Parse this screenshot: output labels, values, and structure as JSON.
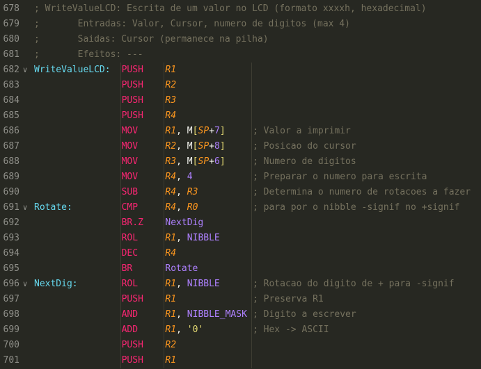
{
  "colors": {
    "background": "#272822",
    "line_number": "#90908a",
    "comment": "#75715e",
    "label": "#66d9ef",
    "instruction": "#f92672",
    "register": "#fd971f",
    "identifier": "#ae81ff",
    "text": "#f8f8f2"
  },
  "lines": [
    {
      "n": "678",
      "fold": "",
      "tokens": [
        {
          "t": "; WriteValueLCD: Escrita de um valor no LCD (formato xxxxh, hexadecimal)",
          "c": "comment",
          "col": 0
        }
      ]
    },
    {
      "n": "679",
      "fold": "",
      "tokens": [
        {
          "t": ";       Entradas: Valor, Cursor, numero de digitos (max 4)",
          "c": "comment",
          "col": 0
        }
      ]
    },
    {
      "n": "680",
      "fold": "",
      "tokens": [
        {
          "t": ";       Saidas: Cursor (permanece na pilha)",
          "c": "comment",
          "col": 0
        }
      ]
    },
    {
      "n": "681",
      "fold": "",
      "tokens": [
        {
          "t": ";       Efeitos: ---",
          "c": "comment",
          "col": 0
        }
      ]
    },
    {
      "n": "682",
      "fold": "v",
      "tokens": [
        {
          "t": "WriteValueLCD:",
          "c": "label",
          "col": 0
        },
        {
          "t": "PUSH",
          "c": "instr",
          "col": 16
        },
        {
          "t": "R1",
          "c": "reg",
          "col": 24
        }
      ]
    },
    {
      "n": "683",
      "fold": "",
      "tokens": [
        {
          "t": "PUSH",
          "c": "instr",
          "col": 16
        },
        {
          "t": "R2",
          "c": "reg",
          "col": 24
        }
      ]
    },
    {
      "n": "684",
      "fold": "",
      "tokens": [
        {
          "t": "PUSH",
          "c": "instr",
          "col": 16
        },
        {
          "t": "R3",
          "c": "reg",
          "col": 24
        }
      ]
    },
    {
      "n": "685",
      "fold": "",
      "tokens": [
        {
          "t": "PUSH",
          "c": "instr",
          "col": 16
        },
        {
          "t": "R4",
          "c": "reg",
          "col": 24
        }
      ]
    },
    {
      "n": "686",
      "fold": "",
      "tokens": [
        {
          "t": "MOV",
          "c": "instr",
          "col": 16
        },
        {
          "t": "R1",
          "c": "reg",
          "col": 24
        },
        {
          "t": ", M",
          "c": "plain",
          "col": 26
        },
        {
          "t": "[",
          "c": "bracket",
          "col": 29
        },
        {
          "t": "SP",
          "c": "reg",
          "col": 30
        },
        {
          "t": "+",
          "c": "plain",
          "col": 32
        },
        {
          "t": "7",
          "c": "num",
          "col": 33
        },
        {
          "t": "]",
          "c": "bracket",
          "col": 34
        },
        {
          "t": "; Valor a imprimir",
          "c": "comment",
          "col": 40
        }
      ]
    },
    {
      "n": "687",
      "fold": "",
      "tokens": [
        {
          "t": "MOV",
          "c": "instr",
          "col": 16
        },
        {
          "t": "R2",
          "c": "reg",
          "col": 24
        },
        {
          "t": ", M",
          "c": "plain",
          "col": 26
        },
        {
          "t": "[",
          "c": "bracket",
          "col": 29
        },
        {
          "t": "SP",
          "c": "reg",
          "col": 30
        },
        {
          "t": "+",
          "c": "plain",
          "col": 32
        },
        {
          "t": "8",
          "c": "num",
          "col": 33
        },
        {
          "t": "]",
          "c": "bracket",
          "col": 34
        },
        {
          "t": "; Posicao do cursor",
          "c": "comment",
          "col": 40
        }
      ]
    },
    {
      "n": "688",
      "fold": "",
      "tokens": [
        {
          "t": "MOV",
          "c": "instr",
          "col": 16
        },
        {
          "t": "R3",
          "c": "reg",
          "col": 24
        },
        {
          "t": ", M",
          "c": "plain",
          "col": 26
        },
        {
          "t": "[",
          "c": "bracket",
          "col": 29
        },
        {
          "t": "SP",
          "c": "reg",
          "col": 30
        },
        {
          "t": "+",
          "c": "plain",
          "col": 32
        },
        {
          "t": "6",
          "c": "num",
          "col": 33
        },
        {
          "t": "]",
          "c": "bracket",
          "col": 34
        },
        {
          "t": "; Numero de digitos",
          "c": "comment",
          "col": 40
        }
      ]
    },
    {
      "n": "689",
      "fold": "",
      "tokens": [
        {
          "t": "MOV",
          "c": "instr",
          "col": 16
        },
        {
          "t": "R4",
          "c": "reg",
          "col": 24
        },
        {
          "t": ", ",
          "c": "plain",
          "col": 26
        },
        {
          "t": "4",
          "c": "num",
          "col": 28
        },
        {
          "t": "; Preparar o numero para escrita",
          "c": "comment",
          "col": 40
        }
      ]
    },
    {
      "n": "690",
      "fold": "",
      "tokens": [
        {
          "t": "SUB",
          "c": "instr",
          "col": 16
        },
        {
          "t": "R4",
          "c": "reg",
          "col": 24
        },
        {
          "t": ", ",
          "c": "plain",
          "col": 26
        },
        {
          "t": "R3",
          "c": "reg",
          "col": 28
        },
        {
          "t": "; Determina o numero de rotacoes a fazer",
          "c": "comment",
          "col": 40
        }
      ]
    },
    {
      "n": "691",
      "fold": "v",
      "tokens": [
        {
          "t": "Rotate:",
          "c": "label",
          "col": 0
        },
        {
          "t": "CMP",
          "c": "instr",
          "col": 16
        },
        {
          "t": "R4",
          "c": "reg",
          "col": 24
        },
        {
          "t": ", ",
          "c": "plain",
          "col": 26
        },
        {
          "t": "R0",
          "c": "reg",
          "col": 28
        },
        {
          "t": "; para por o nibble -signif no +signif",
          "c": "comment",
          "col": 40
        }
      ]
    },
    {
      "n": "692",
      "fold": "",
      "tokens": [
        {
          "t": "BR.Z",
          "c": "instr",
          "col": 16
        },
        {
          "t": "NextDig",
          "c": "ident",
          "col": 24
        }
      ]
    },
    {
      "n": "693",
      "fold": "",
      "tokens": [
        {
          "t": "ROL",
          "c": "instr",
          "col": 16
        },
        {
          "t": "R1",
          "c": "reg",
          "col": 24
        },
        {
          "t": ", ",
          "c": "plain",
          "col": 26
        },
        {
          "t": "NIBBLE",
          "c": "ident",
          "col": 28
        }
      ]
    },
    {
      "n": "694",
      "fold": "",
      "tokens": [
        {
          "t": "DEC",
          "c": "instr",
          "col": 16
        },
        {
          "t": "R4",
          "c": "reg",
          "col": 24
        }
      ]
    },
    {
      "n": "695",
      "fold": "",
      "tokens": [
        {
          "t": "BR",
          "c": "instr",
          "col": 16
        },
        {
          "t": "Rotate",
          "c": "ident",
          "col": 24
        }
      ]
    },
    {
      "n": "696",
      "fold": "v",
      "tokens": [
        {
          "t": "NextDig:",
          "c": "label",
          "col": 0
        },
        {
          "t": "ROL",
          "c": "instr",
          "col": 16
        },
        {
          "t": "R1",
          "c": "reg",
          "col": 24
        },
        {
          "t": ", ",
          "c": "plain",
          "col": 26
        },
        {
          "t": "NIBBLE",
          "c": "ident",
          "col": 28
        },
        {
          "t": "; Rotacao do digito de + para -signif",
          "c": "comment",
          "col": 40
        }
      ]
    },
    {
      "n": "697",
      "fold": "",
      "tokens": [
        {
          "t": "PUSH",
          "c": "instr",
          "col": 16
        },
        {
          "t": "R1",
          "c": "reg",
          "col": 24
        },
        {
          "t": "; Preserva R1",
          "c": "comment",
          "col": 40
        }
      ]
    },
    {
      "n": "698",
      "fold": "",
      "tokens": [
        {
          "t": "AND",
          "c": "instr",
          "col": 16
        },
        {
          "t": "R1",
          "c": "reg",
          "col": 24
        },
        {
          "t": ", ",
          "c": "plain",
          "col": 26
        },
        {
          "t": "NIBBLE_MASK",
          "c": "ident",
          "col": 28
        },
        {
          "t": "; Digito a escrever",
          "c": "comment",
          "col": 40
        }
      ]
    },
    {
      "n": "699",
      "fold": "",
      "tokens": [
        {
          "t": "ADD",
          "c": "instr",
          "col": 16
        },
        {
          "t": "R1",
          "c": "reg",
          "col": 24
        },
        {
          "t": ", ",
          "c": "plain",
          "col": 26
        },
        {
          "t": "'0'",
          "c": "string",
          "col": 28
        },
        {
          "t": "; Hex -> ASCII",
          "c": "comment",
          "col": 40
        }
      ]
    },
    {
      "n": "700",
      "fold": "",
      "tokens": [
        {
          "t": "PUSH",
          "c": "instr",
          "col": 16
        },
        {
          "t": "R2",
          "c": "reg",
          "col": 24
        }
      ]
    },
    {
      "n": "701",
      "fold": "",
      "tokens": [
        {
          "t": "PUSH",
          "c": "instr",
          "col": 16
        },
        {
          "t": "R1",
          "c": "reg",
          "col": 24
        }
      ]
    }
  ]
}
